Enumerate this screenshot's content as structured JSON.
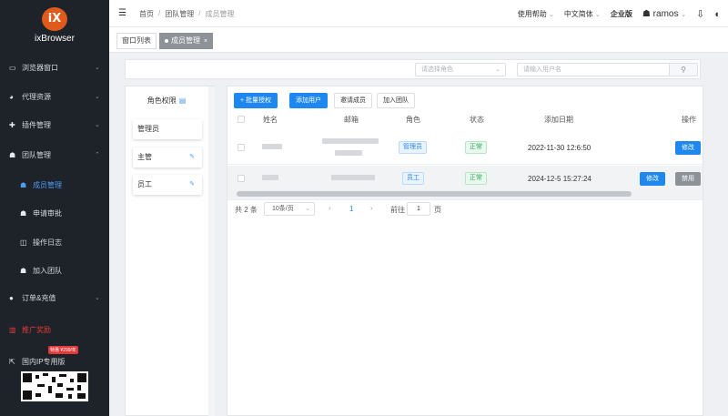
{
  "app": {
    "brand": "ixBrowser",
    "logo_text": "iX"
  },
  "sidebar": {
    "items": [
      {
        "label": "浏览器窗口",
        "icon": "window-icon",
        "glyph": "▭",
        "chevron": "⌄"
      },
      {
        "label": "代理资源",
        "icon": "globe-icon",
        "glyph": "◕",
        "chevron": "⌄"
      },
      {
        "label": "插件管理",
        "icon": "puzzle-icon",
        "glyph": "✚",
        "chevron": "⌄"
      },
      {
        "label": "团队管理",
        "icon": "team-icon",
        "glyph": "☗",
        "chevron": "⌃"
      },
      {
        "label": "成员管理",
        "icon": "member-icon",
        "glyph": "☗"
      },
      {
        "label": "申请审批",
        "icon": "approval-icon",
        "glyph": "☗"
      },
      {
        "label": "操作日志",
        "icon": "log-icon",
        "glyph": "◫"
      },
      {
        "label": "加入团队",
        "icon": "join-icon",
        "glyph": "☗"
      },
      {
        "label": "订单&充值",
        "icon": "order-icon",
        "glyph": "●",
        "chevron": "⌄"
      },
      {
        "label": "推广奖励",
        "icon": "gift-icon",
        "glyph": "▥"
      },
      {
        "label": "国内IP专用版",
        "icon": "external-link-icon",
        "glyph": "⇱"
      }
    ],
    "promo_badge": "特惠 ¥299/年"
  },
  "header": {
    "breadcrumb": [
      "首页",
      "团队管理",
      "成员管理"
    ],
    "help": "使用帮助",
    "language": "中文简体",
    "edition": "企业版",
    "user": "ramos"
  },
  "tabs": [
    {
      "label": "窗口列表"
    },
    {
      "label": "成员管理",
      "close": "×"
    }
  ],
  "filters": {
    "role_placeholder": "请选择角色",
    "search_placeholder": "请输入用户名"
  },
  "roles": {
    "title": "角色权限",
    "list": [
      "管理员",
      "主管",
      "员工"
    ]
  },
  "toolbar": {
    "bulk_auth": "+ 批量授权",
    "add_user": "添加用户",
    "invite": "邀请成员",
    "join": "加入团队"
  },
  "table": {
    "columns": [
      "姓名",
      "邮箱",
      "角色",
      "状态",
      "添加日期",
      "操作"
    ],
    "rows": [
      {
        "role": "管理员",
        "status": "正常",
        "date": "2022-11-30 12:6:50",
        "actions": [
          "修改"
        ]
      },
      {
        "role": "员工",
        "status": "正常",
        "date": "2024-12-5 15:27:24",
        "actions": [
          "修改",
          "禁用"
        ]
      }
    ]
  },
  "pagination": {
    "total": "共 2 条",
    "page_size": "10条/页",
    "current": "1",
    "goto_label": "前往",
    "goto_value": "1",
    "page_suffix": "页"
  },
  "colors": {
    "primary": "#1e88f0",
    "sidebar_bg": "#1e2329",
    "active": "#4d9cf8",
    "success": "#2fa85a"
  }
}
